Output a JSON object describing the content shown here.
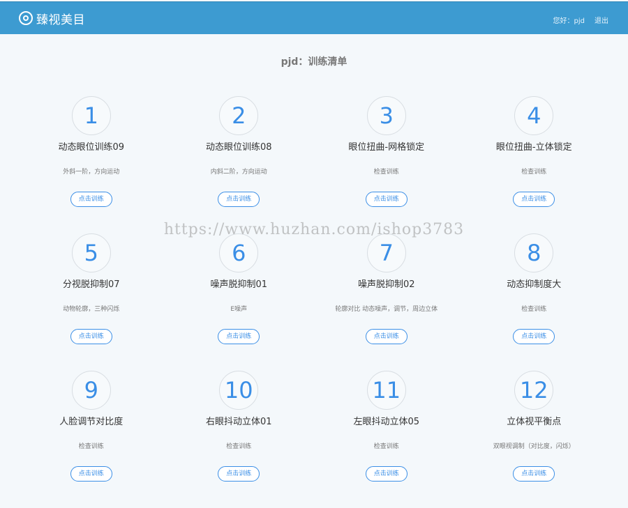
{
  "header": {
    "brand": "臻视美目",
    "greeting": "您好：pjd",
    "logout": "退出"
  },
  "page": {
    "title": "pjd：训练清单"
  },
  "button_label": "点击训练",
  "watermark": "https://www.huzhan.com/ishop3783",
  "cards": [
    {
      "num": "1",
      "title": "动态眼位训练09",
      "desc": "外斜一阶，方向运动"
    },
    {
      "num": "2",
      "title": "动态眼位训练08",
      "desc": "内斜二阶，方向运动"
    },
    {
      "num": "3",
      "title": "眼位扭曲-网格锁定",
      "desc": "检查训练"
    },
    {
      "num": "4",
      "title": "眼位扭曲-立体锁定",
      "desc": "检查训练"
    },
    {
      "num": "5",
      "title": "分视脱抑制07",
      "desc": "动物轮廓，三种闪烁"
    },
    {
      "num": "6",
      "title": "噪声脱抑制01",
      "desc": "E噪声"
    },
    {
      "num": "7",
      "title": "噪声脱抑制02",
      "desc": "轮廓对比 动态噪声，调节，周边立体"
    },
    {
      "num": "8",
      "title": "动态抑制度大",
      "desc": "检查训练"
    },
    {
      "num": "9",
      "title": "人脸调节对比度",
      "desc": "检查训练"
    },
    {
      "num": "10",
      "title": "右眼抖动立体01",
      "desc": "检查训练"
    },
    {
      "num": "11",
      "title": "左眼抖动立体05",
      "desc": "检查训练"
    },
    {
      "num": "12",
      "title": "立体视平衡点",
      "desc": "双眼视调制（对比度，闪烁）"
    }
  ]
}
